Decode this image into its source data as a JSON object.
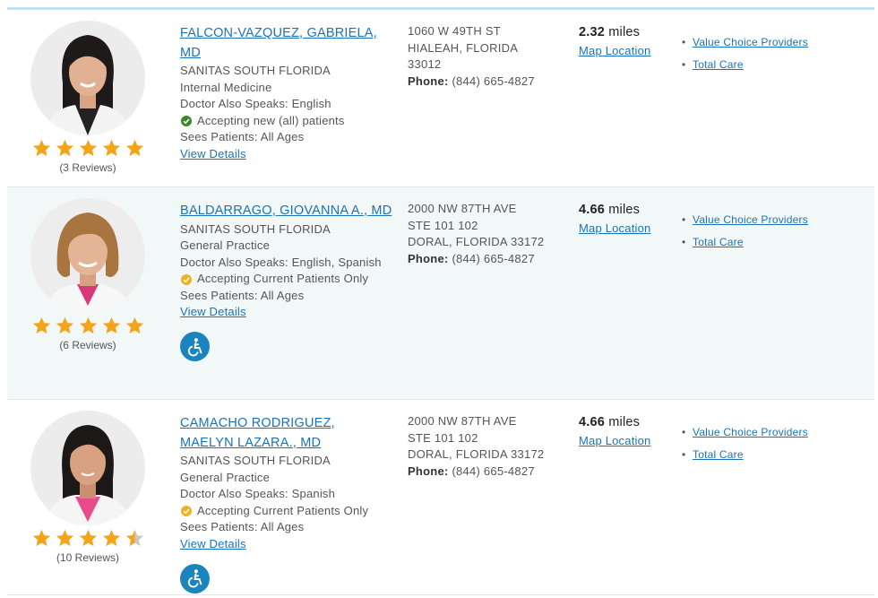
{
  "colors": {
    "link": "#1a73b8",
    "star": "#f4a418",
    "star_empty": "#c8c8c8",
    "accepting_all": "#3a8a2a",
    "accepting_current": "#f0b023",
    "a11y": "#1b84bf",
    "row_alt_bg": "#f2f7f8"
  },
  "providers": [
    {
      "name": "FALCON-VAZQUEZ, GABRIELA, MD",
      "group": "SANITAS SOUTH FLORIDA",
      "specialty": "Internal Medicine",
      "languages": "Doctor Also Speaks: English",
      "status_icon": "check-circle-icon",
      "status": "Accepting new (all) patients",
      "sees": "Sees Patients: All Ages",
      "details_link": "View Details",
      "rating": 5,
      "reviews": "(3 Reviews)",
      "address_line1": "1060 W 49TH ST",
      "address_line2": "HIALEAH, FLORIDA",
      "address_line3": "33012",
      "phone_label": "Phone:",
      "phone": "(844) 665-4827",
      "distance_value": "2.32",
      "distance_unit": "miles",
      "map_link": "Map Location",
      "networks": [
        "Value Choice Providers",
        "Total Care"
      ],
      "wheelchair_accessible": false
    },
    {
      "name": "BALDARRAGO, GIOVANNA A., MD",
      "group": "SANITAS SOUTH FLORIDA",
      "specialty": "General Practice",
      "languages": "Doctor Also Speaks: English, Spanish",
      "status_icon": "alert-circle-icon",
      "status": "Accepting Current Patients Only",
      "sees": "Sees Patients: All Ages",
      "details_link": "View Details",
      "rating": 5,
      "reviews": "(6 Reviews)",
      "address_line1": "2000 NW 87TH AVE",
      "address_line2": "STE 101 102",
      "address_line3": "DORAL, FLORIDA 33172",
      "phone_label": "Phone:",
      "phone": "(844) 665-4827",
      "distance_value": "4.66",
      "distance_unit": "miles",
      "map_link": "Map Location",
      "networks": [
        "Value Choice Providers",
        "Total Care"
      ],
      "wheelchair_accessible": true
    },
    {
      "name": "CAMACHO RODRIGUEZ, MAELYN LAZARA., MD",
      "group": "SANITAS SOUTH FLORIDA",
      "specialty": "General Practice",
      "languages": "Doctor Also Speaks: Spanish",
      "status_icon": "alert-circle-icon",
      "status": "Accepting Current Patients Only",
      "sees": "Sees Patients: All Ages",
      "details_link": "View Details",
      "rating": 4.5,
      "reviews": "(10 Reviews)",
      "address_line1": "2000 NW 87TH AVE",
      "address_line2": "STE 101 102",
      "address_line3": "DORAL, FLORIDA 33172",
      "phone_label": "Phone:",
      "phone": "(844) 665-4827",
      "distance_value": "4.66",
      "distance_unit": "miles",
      "map_link": "Map Location",
      "networks": [
        "Value Choice Providers",
        "Total Care"
      ],
      "wheelchair_accessible": true
    }
  ]
}
